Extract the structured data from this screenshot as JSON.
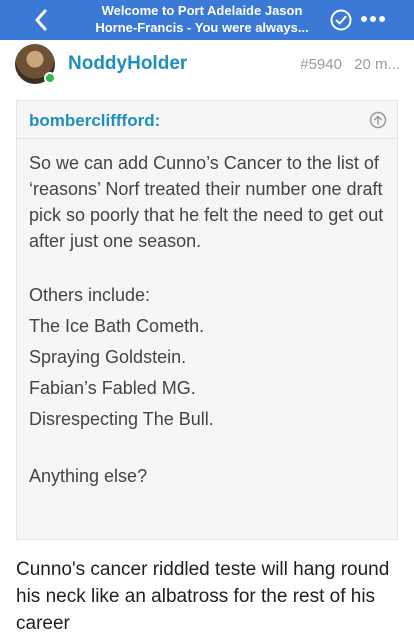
{
  "topbar": {
    "title_line1": "Welcome to Port Adelaide Jason",
    "title_line2": "Horne-Francis - You were always...",
    "back_icon": "chevron-left-icon",
    "check_icon": "check-circle-icon",
    "more_icon": "more-horizontal-icon",
    "color": "#3a79d6"
  },
  "post": {
    "username": "NoddyHolder",
    "post_number": "#5940",
    "time": "20 m...",
    "online_color": "#2fb84e"
  },
  "quote": {
    "author": "bombercliffford:",
    "expand_icon": "arrow-up-circle-icon",
    "paragraph": "So we can add Cunno’s Cancer to the list of ‘reasons’ Norf treated their number one draft pick so poorly that he felt the need to get out after just one season.",
    "lines": [
      "Others include:",
      "The Ice Bath Cometh.",
      "Spraying Goldstein.",
      "Fabian’s Fabled MG.",
      "Disrespecting The Bull."
    ],
    "closing": "Anything else?"
  },
  "reply": {
    "text": "Cunno's cancer riddled teste will hang round his neck like an albatross for the rest of his career"
  }
}
